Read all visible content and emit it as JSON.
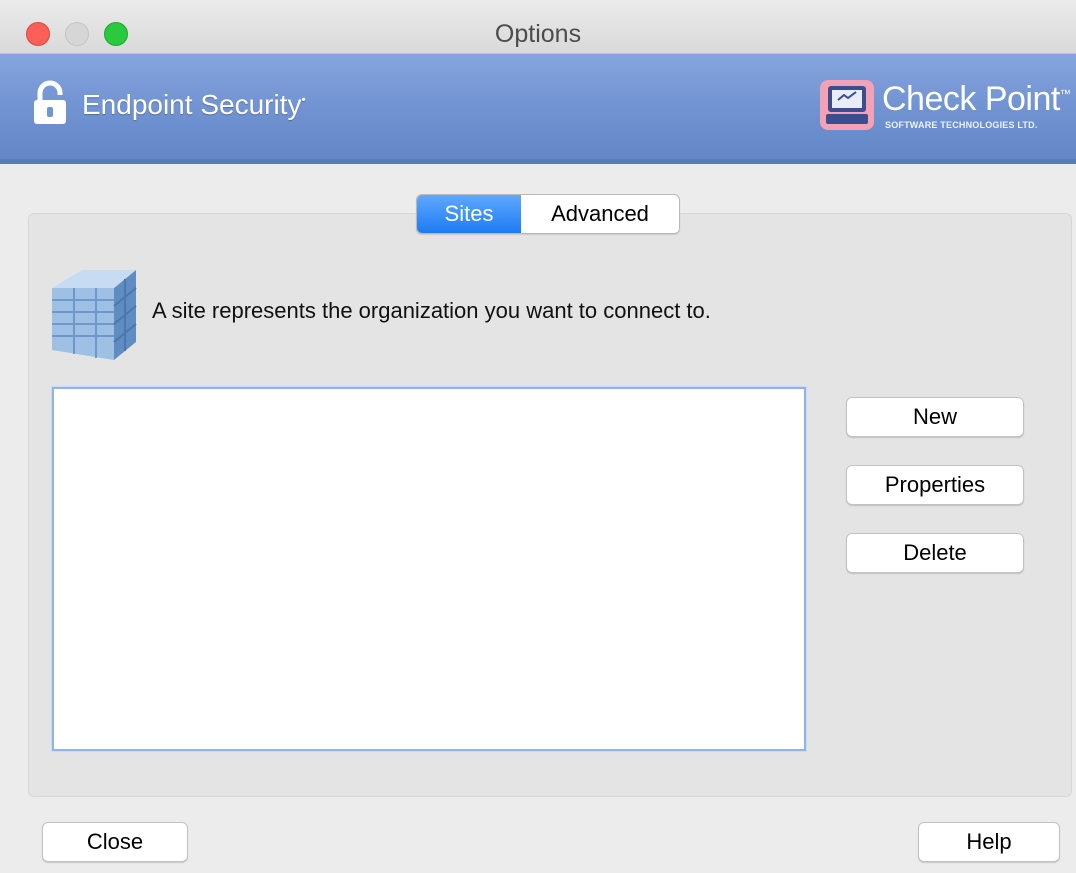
{
  "window": {
    "title": "Options",
    "controls": [
      "close",
      "minimize",
      "zoom"
    ]
  },
  "banner": {
    "product_name": "Endpoint Security",
    "product_mark": "•",
    "brand_name": "Check Point",
    "brand_mark": "™",
    "brand_subtitle": "SOFTWARE TECHNOLOGIES LTD."
  },
  "tabs": [
    {
      "label": "Sites",
      "selected": true
    },
    {
      "label": "Advanced",
      "selected": false
    }
  ],
  "sites": {
    "description": "A site represents the organization you want to connect to.",
    "list_items": []
  },
  "buttons": {
    "new": "New",
    "properties": "Properties",
    "delete": "Delete",
    "close": "Close",
    "help": "Help"
  },
  "colors": {
    "banner": "#7395d3",
    "tab_selected": "#1d7cf2",
    "list_focus_border": "#8fb4ea"
  }
}
